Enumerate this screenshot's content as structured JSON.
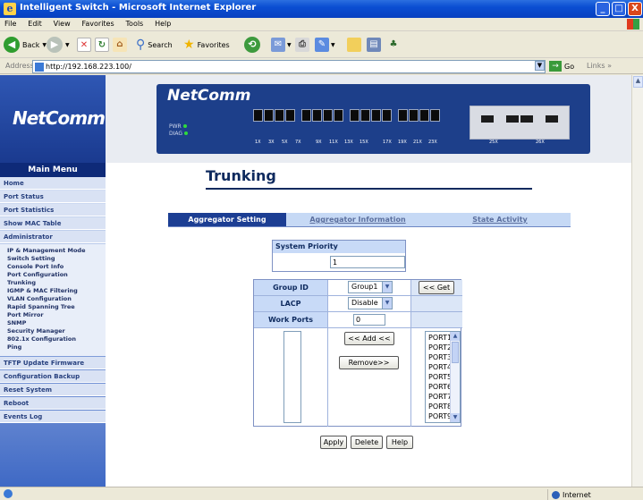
{
  "window": {
    "title": "Intelligent Switch - Microsoft Internet Explorer",
    "minimize": "_",
    "maximize": "□",
    "close": "X"
  },
  "menubar": [
    "File",
    "Edit",
    "View",
    "Favorites",
    "Tools",
    "Help"
  ],
  "toolbar": {
    "back": "Back",
    "search": "Search",
    "favorites": "Favorites"
  },
  "address": {
    "label": "Address",
    "url": "http://192.168.223.100/",
    "go": "Go",
    "links": "Links"
  },
  "header": {
    "logo": "NetComm",
    "device_brand": "NetComm",
    "led_pwr": "PWR",
    "led_diag": "DIAG",
    "port_labels": [
      "1X",
      "3X",
      "5X",
      "7X",
      "9X",
      "11X",
      "13X",
      "15X",
      "17X",
      "19X",
      "21X",
      "23X",
      "25X",
      "26X"
    ]
  },
  "sidebar": {
    "title": "Main Menu",
    "items": [
      "Home",
      "Port Status",
      "Port Statistics",
      "Show MAC Table",
      "Administrator"
    ],
    "admin_sub": [
      "IP & Management Mode",
      "Switch Setting",
      "Console Port Info",
      "Port Configuration",
      "Trunking",
      "IGMP & MAC Filtering",
      "VLAN Configuration",
      "Rapid Spanning Tree",
      "Port Mirror",
      "SNMP",
      "Security Manager",
      "802.1x Configuration",
      "Ping"
    ],
    "bottom_items": [
      "TFTP Update Firmware",
      "Configuration Backup",
      "Reset System",
      "Reboot",
      "Events Log"
    ]
  },
  "page": {
    "title": "Trunking",
    "tabs": [
      "Aggregator Setting",
      "Aggregator Information",
      "State Activity"
    ],
    "system_priority_label": "System Priority",
    "system_priority_value": "1",
    "group_id_label": "Group ID",
    "group_id_value": "Group1",
    "get_button": "<< Get",
    "lacp_label": "LACP",
    "lacp_value": "Disable",
    "work_ports_label": "Work Ports",
    "work_ports_value": "0",
    "add_button": "<< Add <<",
    "remove_button": "Remove>>",
    "ports": [
      "PORT1",
      "PORT2",
      "PORT3",
      "PORT4",
      "PORT5",
      "PORT6",
      "PORT7",
      "PORT8",
      "PORT9"
    ],
    "apply_button": "Apply",
    "delete_button": "Delete",
    "help_button": "Help"
  },
  "status": {
    "zone": "Internet"
  }
}
